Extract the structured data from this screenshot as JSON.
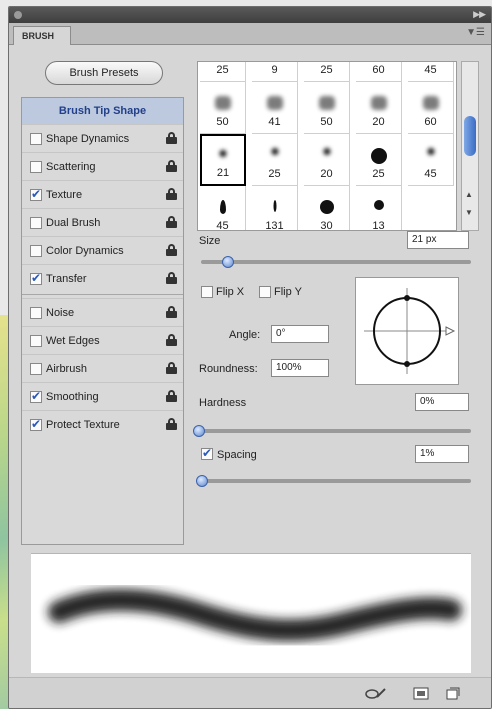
{
  "panel": {
    "tab": "BRUSH"
  },
  "presets_button": "Brush Presets",
  "brush_tip_shape": "Brush Tip Shape",
  "options": [
    {
      "label": "Shape Dynamics",
      "checked": false
    },
    {
      "label": "Scattering",
      "checked": false
    },
    {
      "label": "Texture",
      "checked": true
    },
    {
      "label": "Dual Brush",
      "checked": false
    },
    {
      "label": "Color Dynamics",
      "checked": false
    },
    {
      "label": "Transfer",
      "checked": true
    },
    {
      "label": "Noise",
      "checked": false
    },
    {
      "label": "Wet Edges",
      "checked": false
    },
    {
      "label": "Airbrush",
      "checked": false
    },
    {
      "label": "Smoothing",
      "checked": true
    },
    {
      "label": "Protect Texture",
      "checked": true
    }
  ],
  "brush_grid": {
    "row0": [
      "25",
      "9",
      "25",
      "60",
      "45"
    ],
    "row1": [
      "50",
      "41",
      "50",
      "20",
      "60"
    ],
    "row2": [
      "21",
      "25",
      "20",
      "25",
      "45"
    ],
    "row3": [
      "45",
      "131",
      "30",
      "13"
    ],
    "selected": "21"
  },
  "size": {
    "label": "Size",
    "value": "21 px",
    "fraction": 0.1
  },
  "flip_x": {
    "label": "Flip X",
    "checked": false
  },
  "flip_y": {
    "label": "Flip Y",
    "checked": false
  },
  "angle": {
    "label": "Angle:",
    "value": "0°"
  },
  "roundness": {
    "label": "Roundness:",
    "value": "100%"
  },
  "hardness": {
    "label": "Hardness",
    "value": "0%",
    "fraction": 0.0
  },
  "spacing": {
    "label": "Spacing",
    "value": "1%",
    "checked": true,
    "fraction": 0.01
  }
}
